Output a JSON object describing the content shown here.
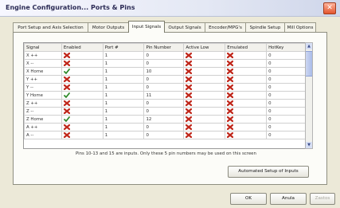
{
  "window": {
    "title": "Engine Configuration... Ports & Pins",
    "close_glyph": "✕"
  },
  "tabs": [
    {
      "label": "Port Setup and Axis Selection",
      "active": false
    },
    {
      "label": "Motor Outputs",
      "active": false
    },
    {
      "label": "Input Signals",
      "active": true
    },
    {
      "label": "Output Signals",
      "active": false
    },
    {
      "label": "Encoder/MPG's",
      "active": false
    },
    {
      "label": "Spindle Setup",
      "active": false
    },
    {
      "label": "Mill Options",
      "active": false
    }
  ],
  "table": {
    "columns": [
      "Signal",
      "Enabled",
      "Port #",
      "Pin Number",
      "Active Low",
      "Emulated",
      "HotKey"
    ],
    "rows": [
      {
        "signal": "X ++",
        "enabled": false,
        "port": "1",
        "pin": "0",
        "active_low": false,
        "emulated": false,
        "hotkey": "0"
      },
      {
        "signal": "X --",
        "enabled": false,
        "port": "1",
        "pin": "0",
        "active_low": false,
        "emulated": false,
        "hotkey": "0"
      },
      {
        "signal": "X Home",
        "enabled": true,
        "port": "1",
        "pin": "10",
        "active_low": false,
        "emulated": false,
        "hotkey": "0"
      },
      {
        "signal": "Y ++",
        "enabled": false,
        "port": "1",
        "pin": "0",
        "active_low": false,
        "emulated": false,
        "hotkey": "0"
      },
      {
        "signal": "Y --",
        "enabled": false,
        "port": "1",
        "pin": "0",
        "active_low": false,
        "emulated": false,
        "hotkey": "0"
      },
      {
        "signal": "Y Home",
        "enabled": true,
        "port": "1",
        "pin": "11",
        "active_low": false,
        "emulated": false,
        "hotkey": "0"
      },
      {
        "signal": "Z ++",
        "enabled": false,
        "port": "1",
        "pin": "0",
        "active_low": false,
        "emulated": false,
        "hotkey": "0"
      },
      {
        "signal": "Z --",
        "enabled": false,
        "port": "1",
        "pin": "0",
        "active_low": false,
        "emulated": false,
        "hotkey": "0"
      },
      {
        "signal": "Z Home",
        "enabled": true,
        "port": "1",
        "pin": "12",
        "active_low": false,
        "emulated": false,
        "hotkey": "0"
      },
      {
        "signal": "A ++",
        "enabled": false,
        "port": "1",
        "pin": "0",
        "active_low": false,
        "emulated": false,
        "hotkey": "0"
      },
      {
        "signal": "A --",
        "enabled": false,
        "port": "1",
        "pin": "0",
        "active_low": false,
        "emulated": false,
        "hotkey": "0"
      }
    ]
  },
  "icons": {
    "disabled": "red-x-icon",
    "enabled": "green-check-icon",
    "colors": {
      "red": "#c0281c",
      "green": "#2e8a2a"
    }
  },
  "note": "Pins 10-13 and 15 are inputs. Only these 5 pin numbers may be used on this screen",
  "buttons": {
    "auto_setup": "Automated Setup of Inputs",
    "ok": "OK",
    "apply": "Anula",
    "cancel": "Zastos"
  }
}
